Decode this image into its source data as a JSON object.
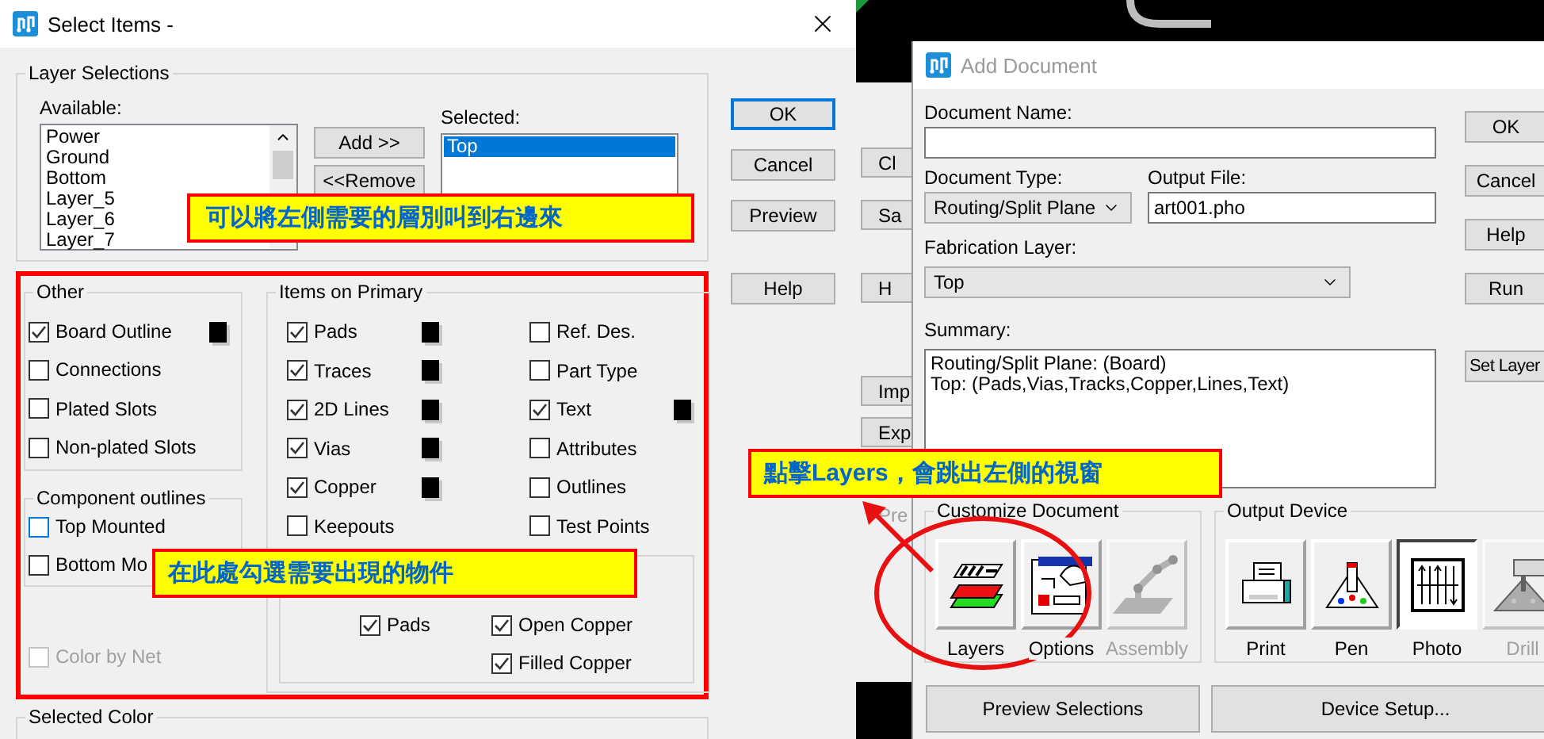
{
  "select_items": {
    "title": "Select Items -",
    "active": true,
    "layer_selections": {
      "title": "Layer Selections",
      "available_label": "Available:",
      "available": [
        {
          "label": "Power",
          "selected": false
        },
        {
          "label": "Ground",
          "selected": false
        },
        {
          "label": "Bottom",
          "selected": false
        },
        {
          "label": "Layer_5",
          "selected": false
        },
        {
          "label": "Layer_6",
          "selected": false
        },
        {
          "label": "Layer_7",
          "selected": false
        }
      ],
      "add_button": "Add >>",
      "remove_button": "<<Remove",
      "selected_label": "Selected:",
      "selected": [
        {
          "label": "Top",
          "selected": true
        }
      ]
    },
    "buttons": [
      {
        "label": "OK",
        "default": true
      },
      {
        "label": "Cancel",
        "default": false
      },
      {
        "label": "Preview",
        "default": false
      },
      {
        "label": "Help",
        "default": false
      }
    ],
    "other": {
      "title": "Other",
      "items": [
        {
          "label": "Board Outline",
          "checked": true,
          "swatch": true
        },
        {
          "label": "Connections",
          "checked": false,
          "swatch": false
        },
        {
          "label": "Plated Slots",
          "checked": false,
          "swatch": false
        },
        {
          "label": "Non-plated Slots",
          "checked": false,
          "swatch": false
        }
      ]
    },
    "component_outlines": {
      "title": "Component outlines",
      "items": [
        {
          "label": "Top Mounted",
          "checked": false,
          "focused": true
        },
        {
          "label": "Bottom Mo",
          "checked": false,
          "focused": false
        }
      ]
    },
    "color_by_net": {
      "label": "Color by Net",
      "checked": false,
      "disabled": true
    },
    "items_on_primary": {
      "title": "Items on Primary",
      "left_column": [
        {
          "label": "Pads",
          "checked": true,
          "swatch": true
        },
        {
          "label": "Traces",
          "checked": true,
          "swatch": true
        },
        {
          "label": "2D Lines",
          "checked": true,
          "swatch": true
        },
        {
          "label": "Vias",
          "checked": true,
          "swatch": true
        },
        {
          "label": "Copper",
          "checked": true,
          "swatch": true
        },
        {
          "label": "Keepouts",
          "checked": false,
          "swatch": false
        }
      ],
      "right_column": [
        {
          "label": "Ref. Des.",
          "checked": false,
          "swatch": false
        },
        {
          "label": "Part Type",
          "checked": false,
          "swatch": false
        },
        {
          "label": "Text",
          "checked": true,
          "swatch": true
        },
        {
          "label": "Attributes",
          "checked": false,
          "swatch": false
        },
        {
          "label": "Outlines",
          "checked": false,
          "swatch": false
        },
        {
          "label": "Test Points",
          "checked": false,
          "swatch": false
        }
      ],
      "copper_rows": [
        [
          {
            "label": "Pads",
            "checked": true
          },
          {
            "label": "Open Copper",
            "checked": true
          }
        ],
        [
          {
            "label": "Filled Copper",
            "checked": true
          }
        ]
      ]
    },
    "selected_color": {
      "title": "Selected Color"
    }
  },
  "back_window": {
    "buttons": [
      {
        "label": "Cl",
        "disabled": false
      },
      {
        "label": "Sa",
        "disabled": false
      },
      {
        "label": "H",
        "disabled": false
      },
      {
        "label": "Imp",
        "disabled": false
      },
      {
        "label": "Exp",
        "disabled": false
      },
      {
        "label": "Pre",
        "disabled": true
      }
    ]
  },
  "add_document": {
    "title": "Add Document",
    "active": false,
    "document_name": {
      "label": "Document Name:"
    },
    "document_type": {
      "label": "Document Type:",
      "value": "Routing/Split Plane"
    },
    "output_file": {
      "label": "Output File:",
      "value": "art001.pho"
    },
    "fabrication_layer": {
      "label": "Fabrication Layer:",
      "value": "Top"
    },
    "summary": {
      "label": "Summary:",
      "lines": [
        "Routing/Split Plane: (Board)",
        "Top: (Pads,Vias,Tracks,Copper,Lines,Text)"
      ]
    },
    "buttons": [
      {
        "label": "OK"
      },
      {
        "label": "Cancel"
      },
      {
        "label": "Help"
      },
      {
        "label": "Run"
      }
    ],
    "set_layers_button": "Set Layer",
    "customize_document": {
      "title": "Customize Document",
      "tools": [
        {
          "kind": "layers",
          "label": "Layers",
          "disabled": false
        },
        {
          "kind": "options",
          "label": "Options",
          "disabled": false
        },
        {
          "kind": "assembly",
          "label": "Assembly",
          "disabled": true
        }
      ]
    },
    "output_device": {
      "title": "Output Device",
      "devices": [
        {
          "kind": "print",
          "label": "Print",
          "selected": false,
          "disabled": false
        },
        {
          "kind": "pen",
          "label": "Pen",
          "selected": false,
          "disabled": false
        },
        {
          "kind": "photo",
          "label": "Photo",
          "selected": true,
          "disabled": false
        },
        {
          "kind": "drill",
          "label": "Drill",
          "selected": false,
          "disabled": true
        }
      ]
    },
    "preview_button": "Preview Selections",
    "device_setup_button": "Device Setup..."
  },
  "callouts": [
    {
      "text": "可以將左側需要的層別叫到右邊來"
    },
    {
      "text": "在此處勾選需要出現的物件"
    },
    {
      "text": "點擊Layers，會跳出左側的視窗"
    }
  ]
}
